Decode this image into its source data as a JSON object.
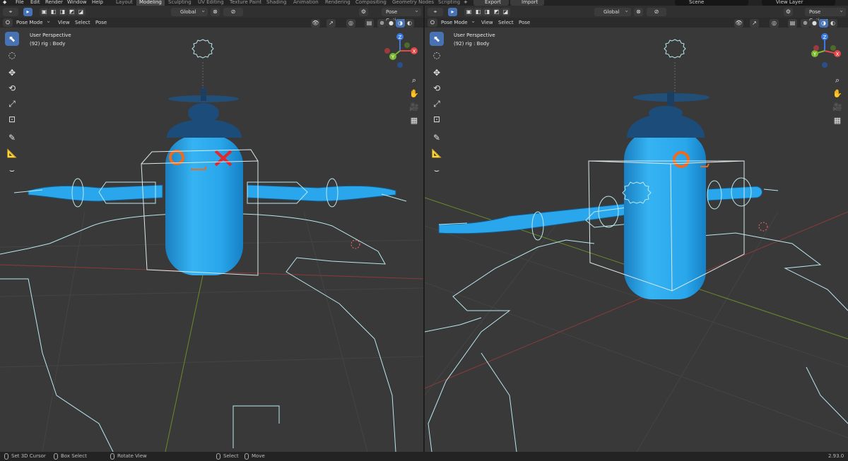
{
  "menu": [
    "File",
    "Edit",
    "Render",
    "Window",
    "Help"
  ],
  "workspace_tabs": [
    "Layout",
    "Modeling",
    "Sculpting",
    "UV Editing",
    "Texture Paint",
    "Shading",
    "Animation",
    "Rendering",
    "Compositing",
    "Geometry Nodes",
    "Scripting"
  ],
  "active_workspace": "Modeling",
  "topbar": {
    "add_tab": "+",
    "export_btn": "Export",
    "import_btn": "Import",
    "scene_field": "Scene",
    "viewlayer_field": "View Layer"
  },
  "viewport": {
    "transform_orientation": "Global",
    "pose_options": "Pose Options",
    "mode": "Pose Mode",
    "header_menu": [
      "View",
      "Select",
      "Pose"
    ],
    "perspective": "User Perspective",
    "active_object": "(92) rig : Body"
  },
  "gizmo_axes": {
    "x": "X",
    "y": "Y",
    "z": "Z"
  },
  "status_bar": {
    "set_cursor": "Set 3D Cursor",
    "box_select": "Box Select",
    "rotate_view": "Rotate View",
    "select": "Select",
    "move": "Move",
    "version": "2.93.0"
  },
  "colors": {
    "viewport_bg": "#393939",
    "header_bg": "#303030",
    "active_blue": "#4772b3",
    "robot_body": "#2aa7ec",
    "robot_cap": "#1c4c7a",
    "face_orange": "#ef6a1c",
    "face_red": "#e3282b",
    "wire": "#bfe8ee",
    "grid": "#484848",
    "axis_red": "#9b3a3a",
    "axis_green": "#6b8f2a"
  }
}
